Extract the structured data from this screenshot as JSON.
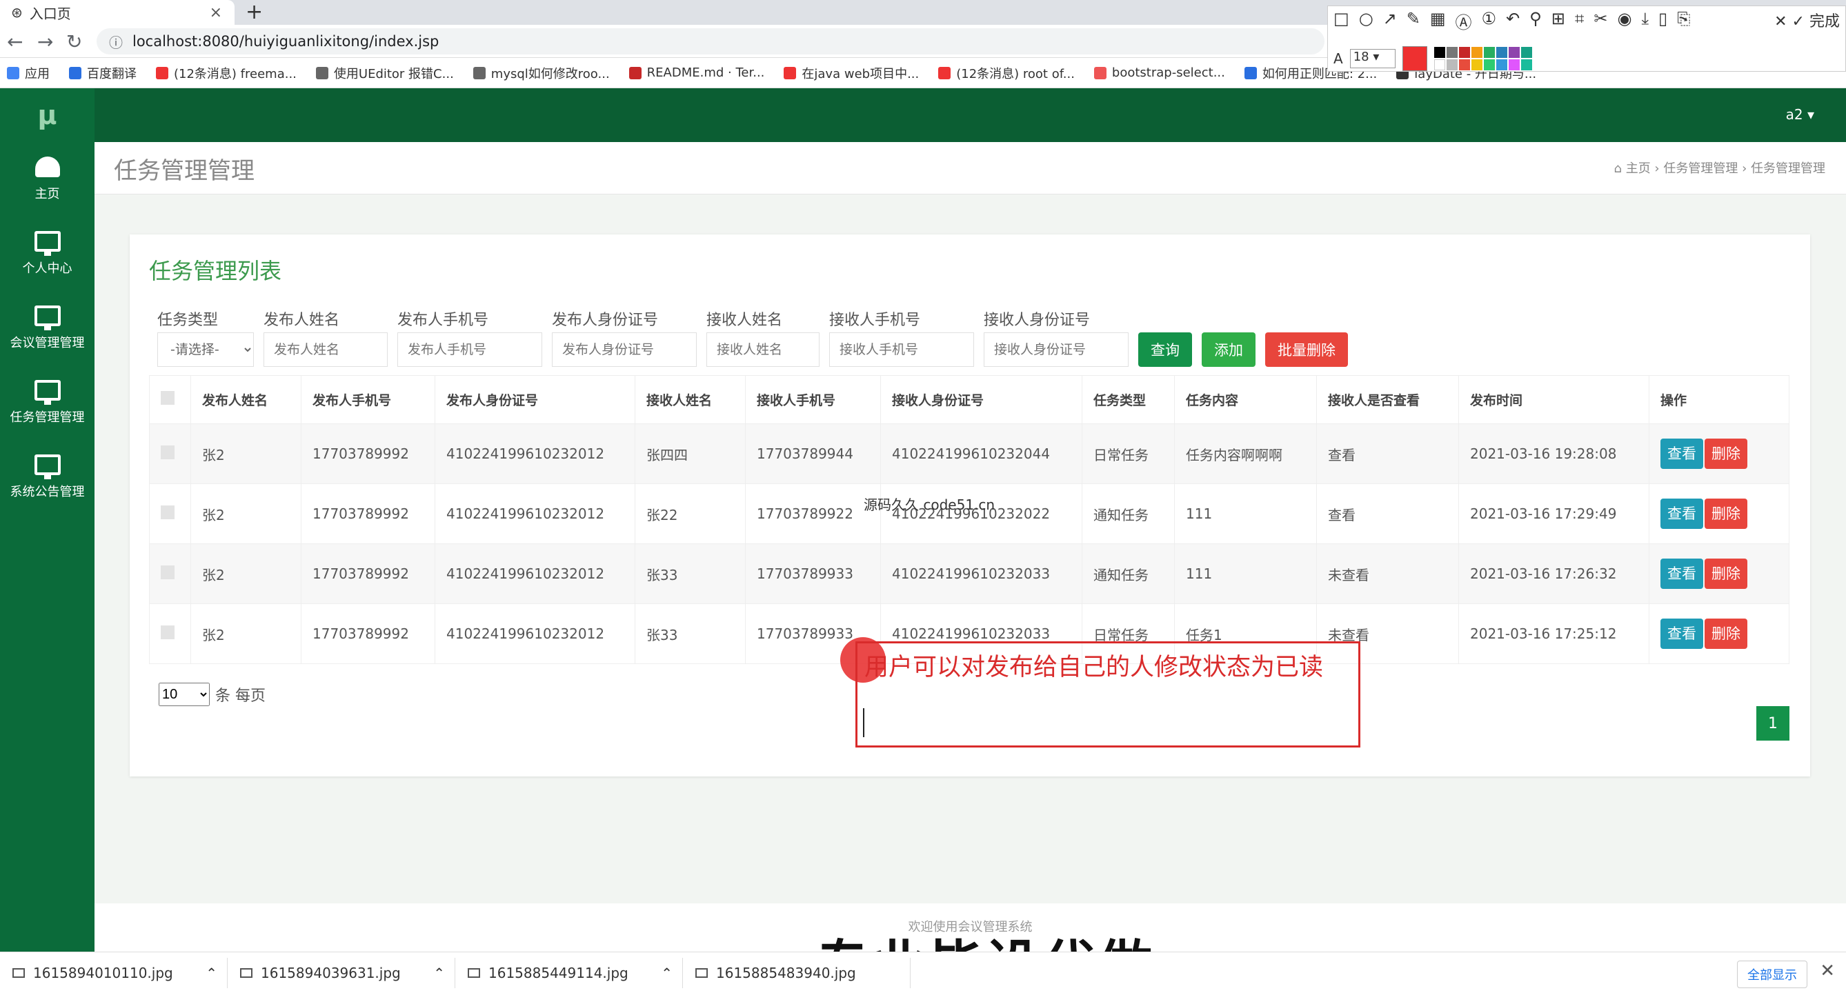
{
  "browser": {
    "tab_title": "入口页",
    "url": "localhost:8080/huiyiguanlixitong/index.jsp",
    "bookmarks": [
      "应用",
      "百度翻译",
      "(12条消息) freema...",
      "使用UEditor 报错C...",
      "mysql如何修改roo...",
      "README.md · Ter...",
      "在java web项目中...",
      "(12条消息) root of...",
      "bootstrap-select...",
      "如何用正则匹配: 2...",
      "layDate - 开日期与..."
    ]
  },
  "snip_toolbar": {
    "font_size": "18",
    "done_label": "完成",
    "accent": "#ee3030"
  },
  "app": {
    "logo": "μ",
    "user": "a2",
    "sidebar": [
      {
        "label": "主页",
        "icon": "dashboard-icon"
      },
      {
        "label": "个人中心",
        "icon": "monitor-icon"
      },
      {
        "label": "会议管理管理",
        "icon": "monitor-icon"
      },
      {
        "label": "任务管理管理",
        "icon": "monitor-icon"
      },
      {
        "label": "系统公告管理",
        "icon": "monitor-icon"
      }
    ],
    "page_title": "任务管理管理",
    "breadcrumb": "主页 › 任务管理管理 › 任务管理管理",
    "footer": "欢迎使用会议管理系统"
  },
  "list": {
    "title": "任务管理列表",
    "filters": {
      "type_label": "任务类型",
      "type_value": "-请选择-",
      "pub_name_label": "发布人姓名",
      "pub_name_ph": "发布人姓名",
      "pub_phone_label": "发布人手机号",
      "pub_phone_ph": "发布人手机号",
      "pub_id_label": "发布人身份证号",
      "pub_id_ph": "发布人身份证号",
      "rec_name_label": "接收人姓名",
      "rec_name_ph": "接收人姓名",
      "rec_phone_label": "接收人手机号",
      "rec_phone_ph": "接收人手机号",
      "rec_id_label": "接收人身份证号",
      "rec_id_ph": "接收人身份证号",
      "query": "查询",
      "add": "添加",
      "batch_delete": "批量删除"
    },
    "columns": [
      "发布人姓名",
      "发布人手机号",
      "发布人身份证号",
      "接收人姓名",
      "接收人手机号",
      "接收人身份证号",
      "任务类型",
      "任务内容",
      "接收人是否查看",
      "发布时间",
      "操作"
    ],
    "rows": [
      [
        "张2",
        "17703789992",
        "410224199610232012",
        "张四四",
        "17703789944",
        "410224199610232044",
        "日常任务",
        "任务内容啊啊啊",
        "查看",
        "2021-03-16 19:28:08"
      ],
      [
        "张2",
        "17703789992",
        "410224199610232012",
        "张22",
        "17703789922",
        "410224199610232022",
        "通知任务",
        "111",
        "查看",
        "2021-03-16 17:29:49"
      ],
      [
        "张2",
        "17703789992",
        "410224199610232012",
        "张33",
        "17703789933",
        "410224199610232033",
        "通知任务",
        "111",
        "未查看",
        "2021-03-16 17:26:32"
      ],
      [
        "张2",
        "17703789992",
        "410224199610232012",
        "张33",
        "17703789933",
        "410224199610232033",
        "日常任务",
        "任务1",
        "未查看",
        "2021-03-16 17:25:12"
      ]
    ],
    "view_btn": "查看",
    "delete_btn": "删除",
    "page_size": "10",
    "per_page": "条 每页",
    "current_page": "1"
  },
  "annotation": {
    "note": "用户可以对发布给自己的人修改状态为已读",
    "overlay_text": "源码久久 code51.cn",
    "subtitle": "专业毕设代做"
  },
  "downloads": {
    "files": [
      "1615894010110.jpg",
      "1615894039631.jpg",
      "1615885449114.jpg",
      "1615885483940.jpg"
    ],
    "show_all": "全部显示"
  }
}
